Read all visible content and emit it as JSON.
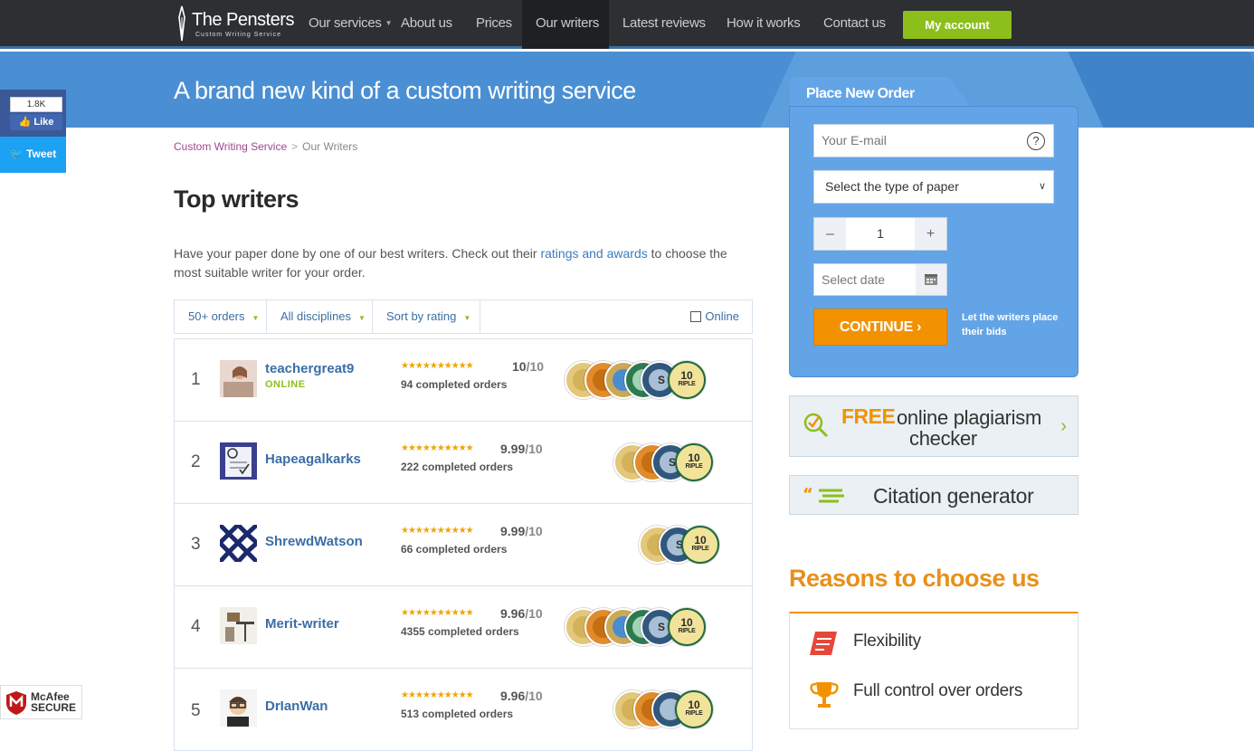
{
  "brand": {
    "name": "The Pensters",
    "tagline": "Custom Writing Service"
  },
  "nav": {
    "items": [
      {
        "label": "Our services",
        "has_caret": true
      },
      {
        "label": "About us"
      },
      {
        "label": "Prices"
      },
      {
        "label": "Our writers",
        "active": true
      },
      {
        "label": "Latest reviews"
      },
      {
        "label": "How it works"
      },
      {
        "label": "Contact us"
      }
    ],
    "account_label": "My account"
  },
  "hero": {
    "title": "A brand new kind of a custom writing service"
  },
  "social": {
    "fb_count": "1.8K",
    "fb_like": "Like",
    "tweet": "Tweet"
  },
  "breadcrumb": {
    "home": "Custom Writing Service",
    "sep": ">",
    "current": "Our Writers"
  },
  "page": {
    "title": "Top writers",
    "intro_before": "Have your paper done by one of our best writers. Check out their ",
    "intro_link": "ratings and awards",
    "intro_after": " to choose the most suitable writer for your order."
  },
  "filters": {
    "orders": "50+ orders",
    "disciplines": "All disciplines",
    "sort": "Sort by rating",
    "online": "Online"
  },
  "writers": [
    {
      "rank": "1",
      "name": "teachergreat9",
      "status": "ONLINE",
      "stars": "★★★★★★★★★★",
      "score": "10",
      "denom": "/10",
      "orders": "94 completed orders"
    },
    {
      "rank": "2",
      "name": "Hapeagalkarks",
      "status": "",
      "stars": "★★★★★★★★★★",
      "score": "9.99",
      "denom": "/10",
      "orders": "222 completed orders"
    },
    {
      "rank": "3",
      "name": "ShrewdWatson",
      "status": "",
      "stars": "★★★★★★★★★★",
      "score": "9.99",
      "denom": "/10",
      "orders": "66 completed orders"
    },
    {
      "rank": "4",
      "name": "Merit-writer",
      "status": "",
      "stars": "★★★★★★★★★★",
      "score": "9.96",
      "denom": "/10",
      "orders": "4355 completed orders"
    },
    {
      "rank": "5",
      "name": "DrIanWan",
      "status": "",
      "stars": "★★★★★★★★★★",
      "score": "9.96",
      "denom": "/10",
      "orders": "513 completed orders"
    }
  ],
  "badges": {
    "ten": "10",
    "triple": "RIPLE",
    "s": "S"
  },
  "order_form": {
    "tab_label": "Place New Order",
    "email_placeholder": "Your E-mail",
    "help": "?",
    "paper_type": "Select the type of paper",
    "minus": "–",
    "quantity": "1",
    "plus": "+",
    "date_placeholder": "Select date",
    "continue": "CONTINUE ›",
    "bids_note": "Let the writers place their bids"
  },
  "plagiarism": {
    "free": "FREE",
    "line1": "online plagiarism",
    "line2": "checker",
    "arrow": "›"
  },
  "citation": {
    "label": "Citation generator"
  },
  "reasons": {
    "title": "Reasons to choose us",
    "items": [
      "Flexibility",
      "Full control over orders"
    ]
  },
  "mcafee": {
    "line1": "McAfee",
    "line2": "SECURE"
  },
  "colors": {
    "nav_bg": "#2e2f33",
    "hero_bg": "#4a8fd3",
    "accent_green": "#8cbf1a",
    "accent_orange": "#f39200",
    "link_blue": "#3b6ea5"
  }
}
